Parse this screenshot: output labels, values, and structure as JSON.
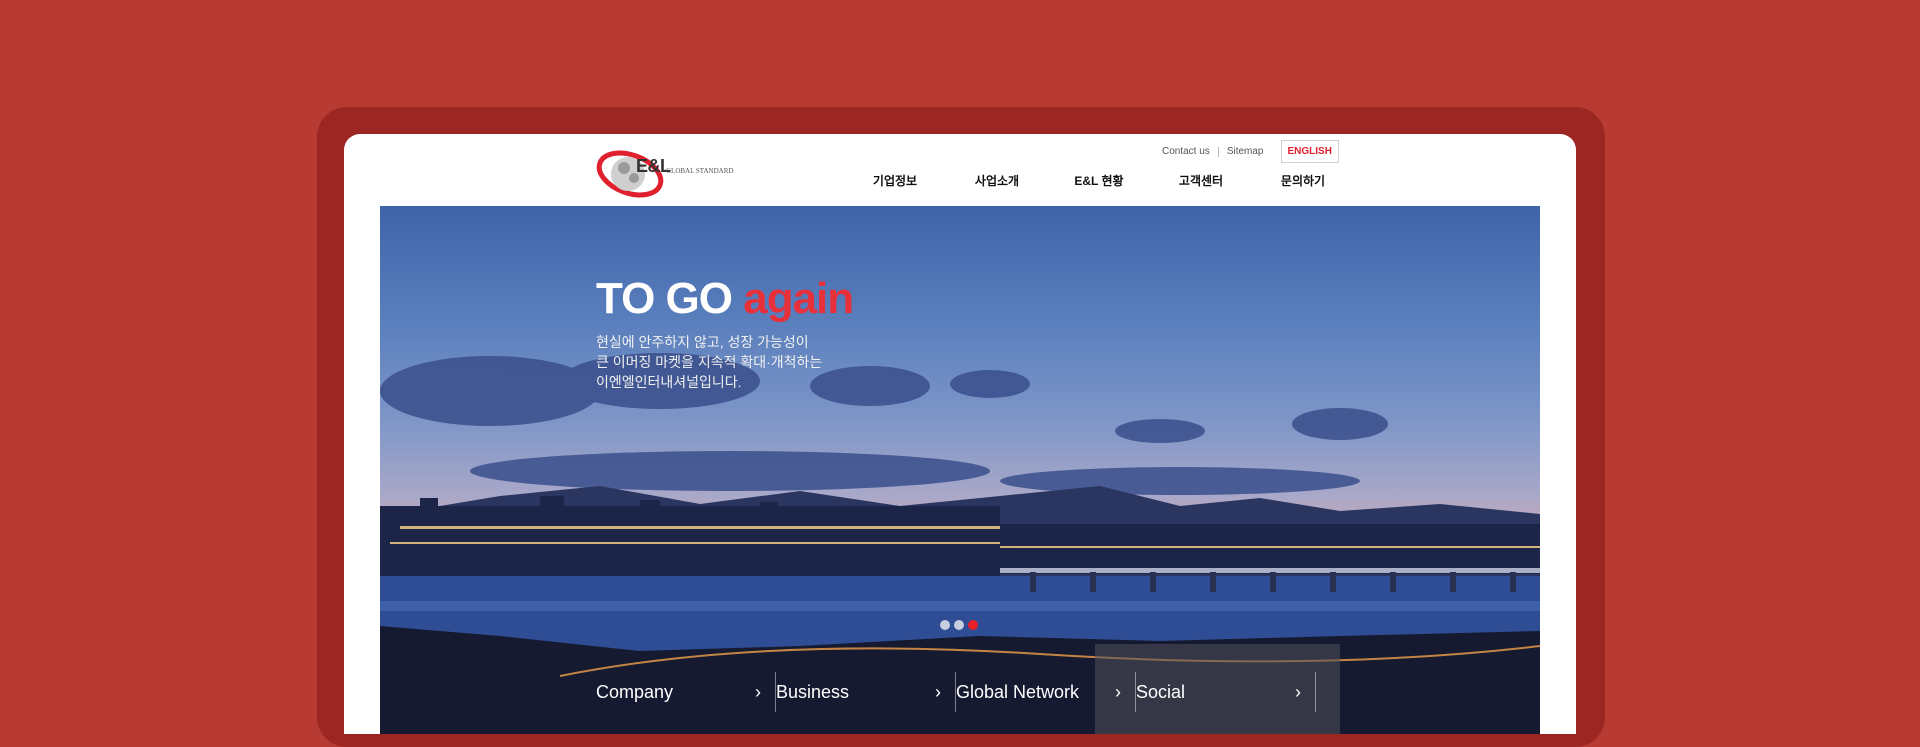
{
  "header": {
    "logo": {
      "text": "E&L",
      "sub": "GLOBAL STANDARD"
    },
    "util_links": [
      "Contact us",
      "Sitemap"
    ],
    "language_button": "ENGLISH",
    "nav": [
      "기업정보",
      "사업소개",
      "E&L 현황",
      "고객센터",
      "문의하기"
    ]
  },
  "hero": {
    "title_main": "TO GO",
    "title_accent": "again",
    "desc_lines": [
      "현실에 안주하지 않고, 성장 가능성이",
      "큰 이머징 마켓을 지속적 확대·개척하는",
      "이엔엘인터내셔널입니다."
    ],
    "slide_total": 3,
    "slide_active": 3
  },
  "quick_links": [
    "Company",
    "Business",
    "Global Network",
    "Social"
  ],
  "colors": {
    "background": "#b73a33",
    "accent": "#e8303a"
  }
}
